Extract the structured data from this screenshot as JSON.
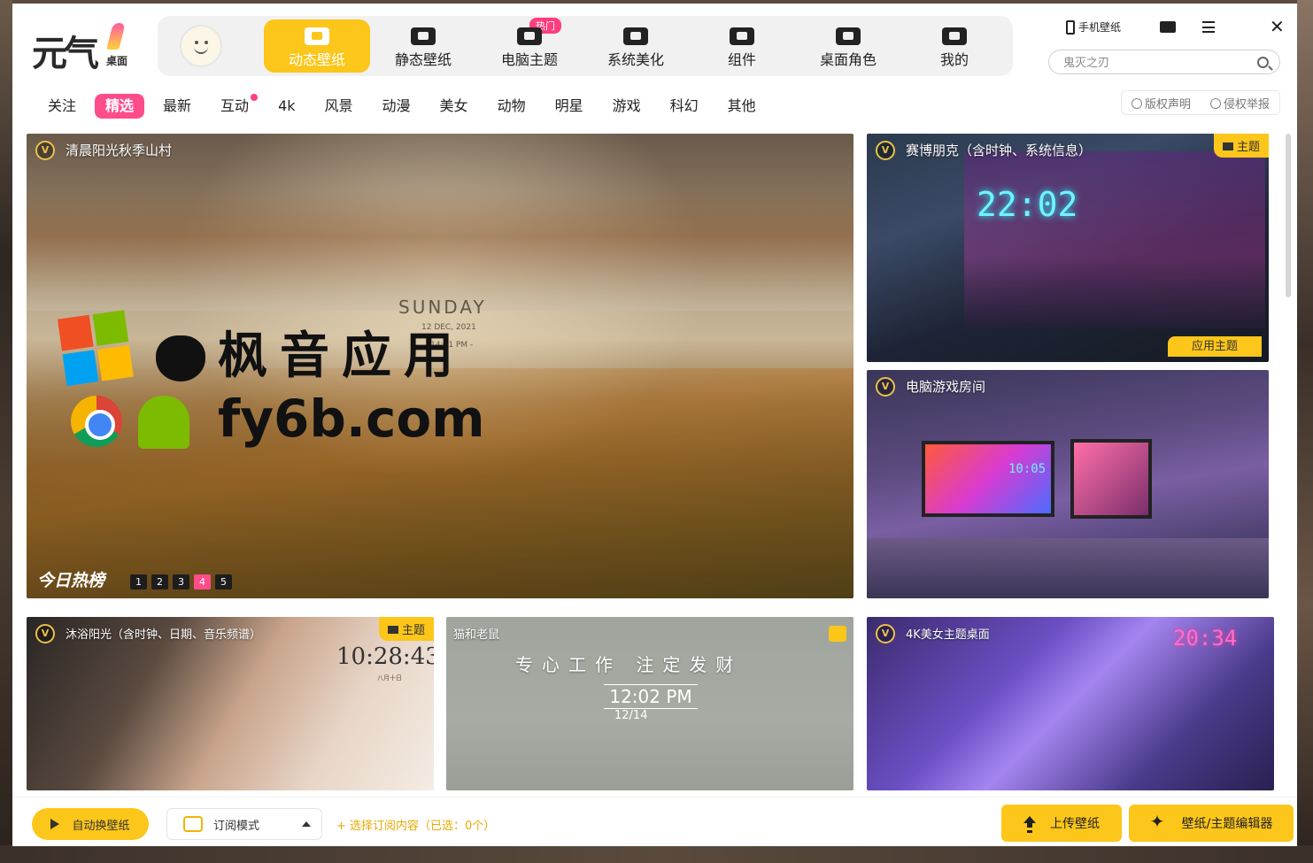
{
  "app": {
    "logo_text": "元气",
    "logo_sub": "桌面"
  },
  "nav": {
    "items": [
      {
        "label": "动态壁纸",
        "icon": "tv-icon",
        "active": true
      },
      {
        "label": "静态壁纸",
        "icon": "image-icon"
      },
      {
        "label": "电脑主题",
        "icon": "monitor-icon",
        "badge": "热门"
      },
      {
        "label": "系统美化",
        "icon": "flower-icon"
      },
      {
        "label": "组件",
        "icon": "widget-icon"
      },
      {
        "label": "桌面角色",
        "icon": "paw-icon"
      },
      {
        "label": "我的",
        "icon": "face-icon"
      }
    ]
  },
  "topbar": {
    "phone_wallpaper": "手机壁纸",
    "search_placeholder": "鬼灭之刃"
  },
  "categories": {
    "items": [
      "关注",
      "精选",
      "最新",
      "互动",
      "4k",
      "风景",
      "动漫",
      "美女",
      "动物",
      "明星",
      "游戏",
      "科幻",
      "其他"
    ],
    "active_index": 1,
    "dot_index": 3
  },
  "legal": {
    "copyright": "版权声明",
    "report": "侵权举报"
  },
  "cards": {
    "main": {
      "title": "清晨阳光秋季山村",
      "badge": "V",
      "overlay_day": "SUNDAY",
      "overlay_date": "12 DEC, 2021",
      "overlay_time": "- 14:41 PM -",
      "hot_label": "今日热榜",
      "pages": [
        "1",
        "2",
        "3",
        "4",
        "5"
      ],
      "active_page": 4
    },
    "watermark": {
      "text": "枫音应用",
      "url": "fy6b.com"
    },
    "cyber": {
      "title": "赛博朋克（含时钟、系统信息）",
      "badge": "V",
      "tag": "主题",
      "clock": "22:02",
      "apply": "应用主题"
    },
    "gaming": {
      "title": "电脑游戏房间",
      "badge": "V",
      "clock": "10:05"
    },
    "bath": {
      "title": "沐浴阳光（含时钟、日期、音乐频谱）",
      "badge": "V",
      "tag": "主题",
      "clock": "10:28:43",
      "date": "八月十日"
    },
    "tom": {
      "title": "猫和老鼠",
      "motto": "专心工作 注定发财",
      "time": "12:02 PM",
      "date": "12/14"
    },
    "beauty": {
      "title": "4K美女主题桌面",
      "badge": "V",
      "clock": "20:34"
    }
  },
  "bottom": {
    "auto_switch": "自动换壁纸",
    "sub_mode": "订阅模式",
    "sub_select": "+ 选择订阅内容（已选：0个）",
    "upload": "上传壁纸",
    "editor": "壁纸/主题编辑器"
  },
  "colors": {
    "accent_yellow": "#fcc61a",
    "accent_pink": "#ff4d8b"
  }
}
